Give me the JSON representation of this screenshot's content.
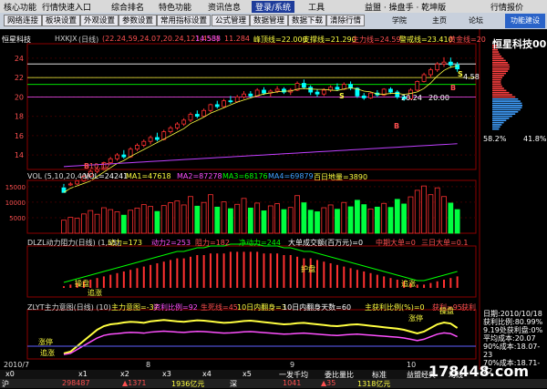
{
  "menu": {
    "items": [
      "核心功能",
      "行情快速入口",
      "综合排名",
      "特色功能",
      "资讯信息",
      "登录/系统",
      "工具",
      "益盟 · 操盘手 · 乾坤版"
    ],
    "right_items": [
      "行情报价"
    ]
  },
  "toolbar": {
    "buttons": [
      "网络连接",
      "板块设置",
      "外观设置",
      "参数设置",
      "常用指标设置",
      "公式管理",
      "数据管理",
      "数据下载",
      "清除行情"
    ],
    "links": [
      "学院",
      "主页",
      "论坛"
    ],
    "brand": "功能建设"
  },
  "main_header": {
    "name": "恒星科技",
    "code": "HXKJX",
    "note": "(日线)",
    "values": "(22.24,59,24.07,20.24,121,453)",
    "extra": [
      "14.588",
      "11.284"
    ],
    "bands": [
      "峰顶线=22.000",
      "支撑线=21.290",
      "主力线=24.59",
      "警戒线=23.410",
      "黄金线=20"
    ]
  },
  "vol_header": {
    "label": "VOL (5,10,20,40)",
    "vol": "VOL=24241",
    "ma1": "MA1=47618",
    "ma2": "MA2=87278",
    "ma3": "MA3=68176",
    "ma4": "MA4=69879",
    "ma5": "百日地量=3890"
  },
  "dlzl_header": {
    "label": "DLZL动力阻力(日线) (1,55)",
    "items": [
      "动力=173",
      "动力2=253",
      "阻力=182",
      "净动力=244",
      "大单成交额(百万元)=0",
      "中期大单=0",
      "三日大单=0.1"
    ]
  },
  "zlyt_header": {
    "label": "ZLYT主力意图(日线) (10)",
    "items": [
      "主力意图=-37",
      "资利比例=92",
      "生死线=45",
      "10日内翻身=3",
      "10日内翻身天数=60",
      "主获利比例(%)=0",
      "获利=95",
      "获利"
    ]
  },
  "annotations": {
    "low_price": "10.12",
    "range_labels": [
      "20.24",
      "20.00"
    ],
    "right_marker": "4.58",
    "s_marks": [
      "S",
      "S"
    ],
    "b_marks": [
      "B",
      "B",
      "B"
    ],
    "dlzl_marks": [
      "操盘",
      "追涨",
      "护盘",
      "追涨"
    ],
    "zlyt_marks": [
      "涨停",
      "追涨",
      "涨停",
      "操盘"
    ]
  },
  "right_panel": {
    "title": "恒星科技00",
    "pct_low": "58.2%",
    "pct_high": "41.8%",
    "info": [
      "日期:2010/10/18",
      "获利比例:80.99%",
      "9.19处获利盘:0%",
      "平均成本:20.07",
      "90%成本:18.07-23",
      "70%成本:18.71-22"
    ]
  },
  "x_axis": {
    "labels": [
      "2010/7",
      "8",
      "9",
      "10"
    ]
  },
  "bottom_tabs": [
    "x0",
    "x1",
    "x2",
    "x3",
    "x4",
    "x5",
    "一发千均",
    "委比量比",
    "标准",
    "益盟经典",
    "均线"
  ],
  "status": {
    "items": [
      "沪",
      "298487",
      "▲1371",
      "1936亿元",
      "深",
      "1041",
      "▲35",
      "1318亿元"
    ]
  },
  "watermark": "178448.com",
  "chart_data": [
    {
      "type": "candlestick",
      "title": "恒星科技",
      "y_ticks": [
        14,
        16,
        18,
        20,
        22,
        24
      ],
      "ylim": [
        12.5,
        25.5
      ],
      "grid": true,
      "candles": [
        [
          10.6,
          11.0,
          10.5,
          10.12
        ],
        [
          10.9,
          11.2,
          10.8,
          11.0
        ],
        [
          11.0,
          11.4,
          10.9,
          11.3
        ],
        [
          11.3,
          11.9,
          11.2,
          11.8
        ],
        [
          11.8,
          12.5,
          11.7,
          12.3
        ],
        [
          12.3,
          12.8,
          12.1,
          12.5
        ],
        [
          12.5,
          13.3,
          12.4,
          13.2
        ],
        [
          13.2,
          13.8,
          13.0,
          13.6
        ],
        [
          13.6,
          14.2,
          13.4,
          14.0
        ],
        [
          14.0,
          14.5,
          13.6,
          13.8
        ],
        [
          13.8,
          14.8,
          13.7,
          14.6
        ],
        [
          14.6,
          15.2,
          14.4,
          15.0
        ],
        [
          15.0,
          15.6,
          14.8,
          15.4
        ],
        [
          15.4,
          16.0,
          15.1,
          15.8
        ],
        [
          15.8,
          16.3,
          15.4,
          15.6
        ],
        [
          15.6,
          16.6,
          15.5,
          16.4
        ],
        [
          16.4,
          17.0,
          16.2,
          16.8
        ],
        [
          16.8,
          17.4,
          16.6,
          17.2
        ],
        [
          17.2,
          17.8,
          17.0,
          17.6
        ],
        [
          17.6,
          18.4,
          17.4,
          18.2
        ],
        [
          18.2,
          18.6,
          17.8,
          18.0
        ],
        [
          18.0,
          18.8,
          17.9,
          18.6
        ],
        [
          18.6,
          19.3,
          18.4,
          19.2
        ],
        [
          19.2,
          19.6,
          18.8,
          19.0
        ],
        [
          19.0,
          19.8,
          18.9,
          19.6
        ],
        [
          19.6,
          20.1,
          19.3,
          19.5
        ],
        [
          19.5,
          20.2,
          19.4,
          20.0
        ],
        [
          20.0,
          20.6,
          19.8,
          20.3
        ],
        [
          20.3,
          20.6,
          19.9,
          20.1
        ],
        [
          20.1,
          20.9,
          20.0,
          20.7
        ],
        [
          20.7,
          21.0,
          20.2,
          20.4
        ],
        [
          20.4,
          20.8,
          20.0,
          20.6
        ],
        [
          20.6,
          21.1,
          20.4,
          20.8
        ],
        [
          20.8,
          21.0,
          20.3,
          20.5
        ],
        [
          20.5,
          20.9,
          20.2,
          20.7
        ],
        [
          20.7,
          21.6,
          20.6,
          21.4
        ],
        [
          21.4,
          21.8,
          20.8,
          21.0
        ],
        [
          21.0,
          21.2,
          20.2,
          20.5
        ],
        [
          20.5,
          20.8,
          20.0,
          20.3
        ],
        [
          20.3,
          20.9,
          20.1,
          20.7
        ],
        [
          20.7,
          21.2,
          20.5,
          21.0
        ],
        [
          21.0,
          21.4,
          20.6,
          20.8
        ],
        [
          20.8,
          21.5,
          20.7,
          21.3
        ],
        [
          21.3,
          21.6,
          20.7,
          20.9
        ],
        [
          20.9,
          21.0,
          19.9,
          20.1
        ],
        [
          20.1,
          20.4,
          19.7,
          19.9
        ],
        [
          19.9,
          20.5,
          19.8,
          20.4
        ],
        [
          20.4,
          20.7,
          20.0,
          20.2
        ],
        [
          20.2,
          20.9,
          20.1,
          20.8
        ],
        [
          20.8,
          21.0,
          20.3,
          20.5
        ],
        [
          20.5,
          20.7,
          19.8,
          20.0
        ],
        [
          20.0,
          20.3,
          19.6,
          19.8
        ],
        [
          19.8,
          20.9,
          19.7,
          20.7
        ],
        [
          20.7,
          21.7,
          20.6,
          21.6
        ],
        [
          21.6,
          22.5,
          21.5,
          22.3
        ],
        [
          22.3,
          23.0,
          22.0,
          22.8
        ],
        [
          22.8,
          23.6,
          22.6,
          23.4
        ],
        [
          23.4,
          24.1,
          23.1,
          23.6
        ],
        [
          23.6,
          24.07,
          23.0,
          23.3
        ],
        [
          23.3,
          23.6,
          22.6,
          22.9
        ]
      ]
    },
    {
      "type": "bar",
      "title": "VOL",
      "y_ticks": [
        5000,
        10000,
        15000
      ],
      "ylim": [
        0,
        17000
      ],
      "values": [
        4200,
        5100,
        4800,
        6200,
        7300,
        6100,
        8200,
        7600,
        6900,
        5800,
        7400,
        8100,
        9200,
        8600,
        7000,
        8900,
        9800,
        10400,
        9100,
        11800,
        8700,
        9900,
        12400,
        8400,
        10100,
        7900,
        9300,
        11200,
        8100,
        9700,
        7200,
        8800,
        9500,
        7600,
        8300,
        12100,
        9800,
        7400,
        6900,
        8200,
        9100,
        7700,
        9900,
        8500,
        10600,
        9200,
        7800,
        8400,
        9600,
        8300,
        10900,
        9400,
        11700,
        13800,
        15200,
        12400,
        14600,
        11800,
        9700,
        7600
      ],
      "up": [
        1,
        1,
        1,
        1,
        1,
        1,
        1,
        1,
        1,
        0,
        1,
        1,
        1,
        1,
        0,
        1,
        1,
        1,
        1,
        1,
        0,
        1,
        1,
        0,
        1,
        0,
        1,
        1,
        0,
        1,
        0,
        1,
        1,
        0,
        1,
        1,
        0,
        0,
        0,
        1,
        1,
        0,
        1,
        0,
        0,
        0,
        1,
        0,
        1,
        0,
        0,
        0,
        1,
        1,
        1,
        1,
        1,
        1,
        0,
        0
      ]
    },
    {
      "type": "bar",
      "title": "DLZL",
      "series": [
        {
          "name": "动力",
          "values": [
            1,
            2,
            3,
            4,
            5,
            6,
            7,
            8,
            9,
            10,
            11,
            12,
            13,
            14,
            15,
            16,
            17,
            18,
            18,
            19,
            20,
            20,
            21,
            21,
            21,
            22,
            22,
            22,
            22,
            22,
            21,
            21,
            21,
            20,
            20,
            19,
            18,
            18,
            17,
            16,
            15,
            14,
            13,
            12,
            11,
            10,
            9,
            8,
            7,
            6,
            5,
            4,
            3,
            2,
            2,
            3,
            4,
            5,
            6,
            7
          ]
        }
      ]
    },
    {
      "type": "line",
      "title": "ZLYT",
      "series": [
        {
          "name": "主力意图",
          "values": [
            -40,
            -35,
            -20,
            -5,
            10,
            25,
            35,
            40,
            42,
            45,
            47,
            46,
            44,
            48,
            50,
            52,
            50,
            48,
            47,
            49,
            51,
            50,
            48,
            46,
            44,
            45,
            47,
            49,
            50,
            48,
            46,
            44,
            42,
            40,
            41,
            43,
            44,
            42,
            40,
            38,
            36,
            35,
            37,
            39,
            40,
            38,
            36,
            34,
            32,
            30,
            28,
            25,
            20,
            15,
            20,
            30,
            40,
            45,
            42,
            30
          ]
        }
      ]
    }
  ]
}
